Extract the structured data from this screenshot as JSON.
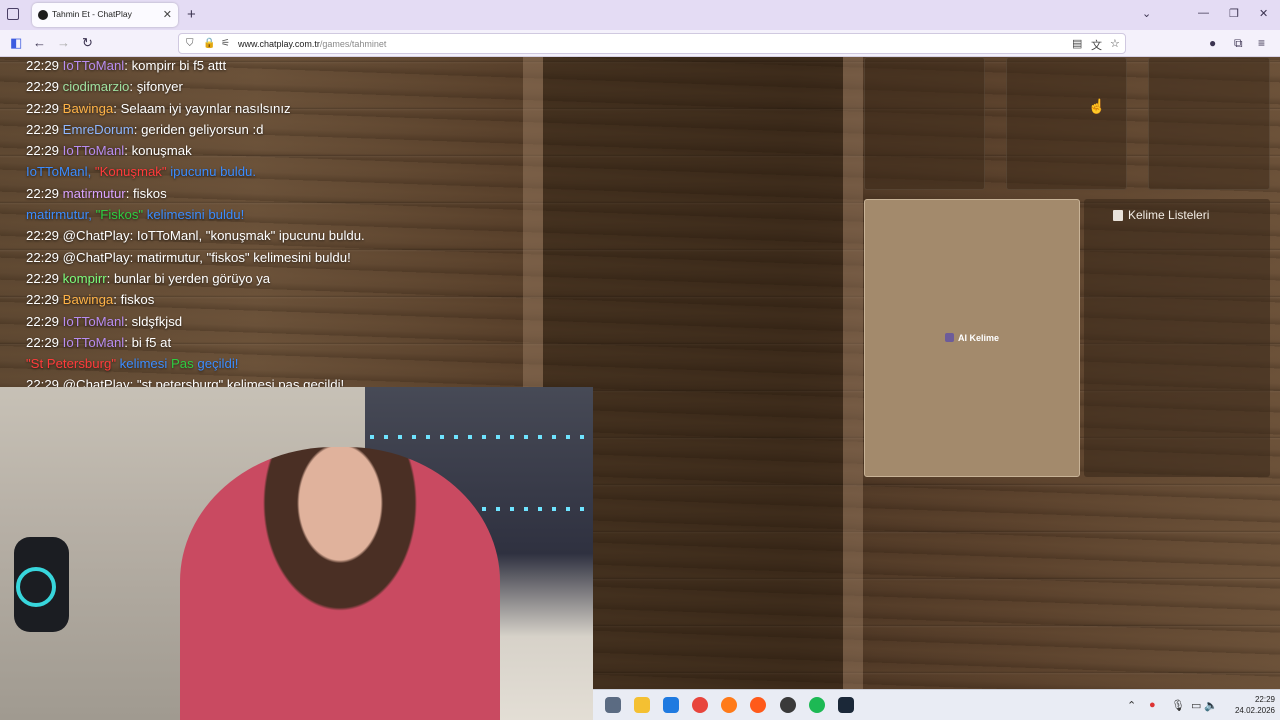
{
  "browser": {
    "tab_title": "Tahmin Et - ChatPlay",
    "url_host": "www.chatplay.com.tr",
    "url_path": "/games/tahminet"
  },
  "game": {
    "ai_word_label": "AI Kelime",
    "word_lists_label": "Kelime Listeleri"
  },
  "chat": [
    {
      "time": "22:29",
      "user": "IoTToManl",
      "user_color": "#b98df0",
      "text": ": kompirr bi f5 attt"
    },
    {
      "time": "22:29",
      "user": "ciodimarzio",
      "user_color": "#9fe0a0",
      "text": ": şifonyer"
    },
    {
      "time": "22:29",
      "user": "Bawinga",
      "user_color": "#ffb347",
      "text": ": Selaam iyi yayınlar nasılsınız"
    },
    {
      "time": "22:29",
      "user": "EmreDorum",
      "user_color": "#8fb7ff",
      "text": ": geriden geliyorsun :d"
    },
    {
      "time": "22:29",
      "user": "IoTToManl",
      "user_color": "#b98df0",
      "text": ": konuşmak"
    },
    {
      "time": "",
      "user": "IoTToManl, ",
      "user_color": "#3b8cff",
      "highlight": "\"Konuşmak\"",
      "highlight_color": "#ff3b3b",
      "text": " ipucunu buldu.",
      "text_color": "#3b8cff"
    },
    {
      "time": "22:29",
      "user": "matirmutur",
      "user_color": "#d9a3ff",
      "text": ": fiskos"
    },
    {
      "time": "",
      "user": "matirmutur, ",
      "user_color": "#3b8cff",
      "highlight": "\"Fiskos\"",
      "highlight_color": "#2ecc40",
      "text": " kelimesini buldu!",
      "text_color": "#3b8cff"
    },
    {
      "time": "22:29",
      "user": "@ChatPlay",
      "user_color": "#ffffff",
      "text": ": IoTToManl, \"konuşmak\" ipucunu buldu."
    },
    {
      "time": "22:29",
      "user": "@ChatPlay",
      "user_color": "#ffffff",
      "text": ": matirmutur, \"fiskos\" kelimesini buldu!"
    },
    {
      "time": "22:29",
      "user": "kompirr",
      "user_color": "#7dff7d",
      "text": ": bunlar bi yerden görüyo ya"
    },
    {
      "time": "22:29",
      "user": "Bawinga",
      "user_color": "#ffb347",
      "text": ": fiskos"
    },
    {
      "time": "22:29",
      "user": "IoTToManl",
      "user_color": "#b98df0",
      "text": ": sldşfkjsd"
    },
    {
      "time": "22:29",
      "user": "IoTToManl",
      "user_color": "#b98df0",
      "text": ": bi f5 at"
    },
    {
      "time": "",
      "user": "\"St Petersburg\"",
      "user_color": "#ff3b3b",
      "highlight": " kelimesi ",
      "highlight_color": "#3b8cff",
      "text": "Pas",
      "text_color": "#2ecc40",
      "suffix": " geçildi!",
      "suffix_color": "#3b8cff"
    },
    {
      "time": "22:29",
      "user": "@ChatPlay",
      "user_color": "#ffffff",
      "text": ": \"st petersburg\" kelimesi pas geçildi!"
    }
  ],
  "taskbar": {
    "time": "22:29",
    "date": "24.02.2026"
  }
}
